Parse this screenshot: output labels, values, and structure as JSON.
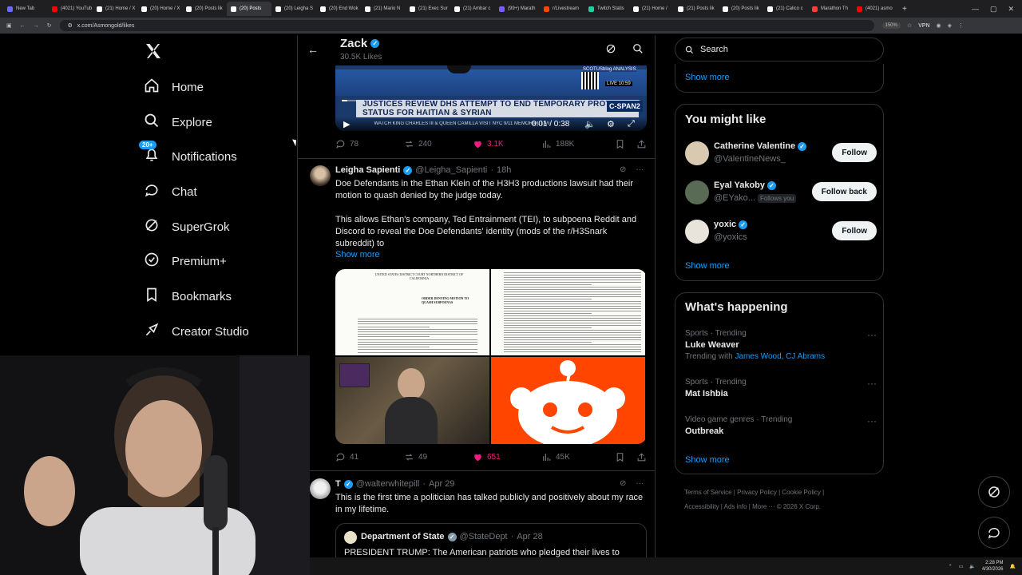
{
  "browser": {
    "tabs": [
      {
        "label": "New Tab",
        "color": "#6b6bff"
      },
      {
        "label": "(4021) YouTub",
        "color": "#ff0000"
      },
      {
        "label": "(21) Home / X",
        "color": "#ffffff"
      },
      {
        "label": "(20) Home / X",
        "color": "#ffffff"
      },
      {
        "label": "(20) Posts lik",
        "color": "#ffffff"
      },
      {
        "label": "(20) Posts",
        "color": "#ffffff"
      },
      {
        "label": "(20) Leigha S",
        "color": "#ffffff"
      },
      {
        "label": "(20) End Wok",
        "color": "#ffffff"
      },
      {
        "label": "(21) Mario N",
        "color": "#ffffff"
      },
      {
        "label": "(21) Exec Sur",
        "color": "#ffffff"
      },
      {
        "label": "(21) Ambar c",
        "color": "#ffffff"
      },
      {
        "label": "(99+) Marath",
        "color": "#7b5cff"
      },
      {
        "label": "r/Livestream",
        "color": "#ff4500"
      },
      {
        "label": "Twitch Statis",
        "color": "#1dd1a1"
      },
      {
        "label": "(21) Home /",
        "color": "#ffffff"
      },
      {
        "label": "(21) Posts lik",
        "color": "#ffffff"
      },
      {
        "label": "(20) Posts lik",
        "color": "#ffffff"
      },
      {
        "label": "(21) Calico c",
        "color": "#ffffff"
      },
      {
        "label": "Marathon Th",
        "color": "#ff3b3b"
      },
      {
        "label": "(4021) asmo",
        "color": "#ff0000"
      }
    ],
    "url": "x.com/Asmongold/likes",
    "zoom": "150%",
    "vpn_label": "VPN",
    "new_tab_symbol": "+"
  },
  "nav": {
    "items": [
      {
        "label": "Home",
        "icon": "home-icon"
      },
      {
        "label": "Explore",
        "icon": "search-icon"
      },
      {
        "label": "Notifications",
        "icon": "bell-icon",
        "badge": "20+"
      },
      {
        "label": "Chat",
        "icon": "chat-icon"
      },
      {
        "label": "SuperGrok",
        "icon": "grok-icon"
      },
      {
        "label": "Premium+",
        "icon": "premium-icon"
      },
      {
        "label": "Bookmarks",
        "icon": "bookmark-icon"
      },
      {
        "label": "Creator Studio",
        "icon": "creator-icon"
      }
    ]
  },
  "header": {
    "name": "Zack",
    "subtitle": "30.5K Likes"
  },
  "video_post": {
    "chyron": "JUSTICES REVIEW DHS ATTEMPT TO END TEMPORARY PROTECTED STATUS FOR HAITIAN & SYRIAN",
    "ticker": "WATCH KING CHARLES III & QUEEN CAMILLA VISIT NYC 9/11 MEMORIAL LIVE 1pm ET C-SPAN",
    "network": "C-SPAN2",
    "live_time": "LIVE 10:59",
    "watermark": "SCOTUSblog ANALYSIS",
    "time": "0:01 / 0:38",
    "progress": 0.02,
    "replies": "78",
    "reposts": "240",
    "likes": "3.1K",
    "views": "188K"
  },
  "tweet1": {
    "name": "Leigha Sapienti",
    "handle": "@Leigha_Sapienti",
    "time": "18h",
    "text": "Doe Defendants in the Ethan Klein of the H3H3 productions lawsuit had their motion to quash denied by the judge today.\n\nThis allows Ethan's company, Ted Entrainment (TEI), to subpoena Reddit and Discord to reveal the Doe Defendants' identity (mods of the r/H3Snark subreddit) to",
    "show_more": "Show more",
    "doc_header": "UNITED STATES DISTRICT COURT NORTHERN DISTRICT OF CALIFORNIA",
    "doc_title": "ORDER DENYING MOTION TO QUASH SUBPOENAS",
    "replies": "41",
    "reposts": "49",
    "likes": "651",
    "views": "45K"
  },
  "tweet2": {
    "name": "T",
    "handle": "@walterwhitepill",
    "time": "Apr 29",
    "text": "This is the first time a politician has talked publicly and positively about my race in my lifetime.",
    "quote_name": "Department of State",
    "quote_handle": "@StateDept",
    "quote_time": "Apr 28",
    "quote_text": "PRESIDENT TRUMP: The American patriots who pledged their lives to"
  },
  "right": {
    "search_placeholder": "Search",
    "show_more": "Show more",
    "you_might_like": "You might like",
    "suggestions": [
      {
        "name": "Catherine Valentine",
        "handle": "@ValentineNews_",
        "button": "Follow",
        "follows_you": "",
        "color": "#d8c9b0"
      },
      {
        "name": "Eyal Yakoby",
        "handle": "@EYako...",
        "button": "Follow back",
        "follows_you": "Follows you",
        "color": "#5a6b55"
      },
      {
        "name": "yoxic",
        "handle": "@yoxics",
        "button": "Follow",
        "follows_you": "",
        "color": "#e8e4dc"
      }
    ],
    "whats_happening": "What's happening",
    "trends": [
      {
        "meta": "Sports · Trending",
        "title": "Luke Weaver",
        "sub_prefix": "Trending with",
        "sub_links": "James Wood, CJ Abrams"
      },
      {
        "meta": "Sports · Trending",
        "title": "Mat Ishbia",
        "sub_prefix": "",
        "sub_links": ""
      },
      {
        "meta": "Video game genres · Trending",
        "title": "Outbreak",
        "sub_prefix": "",
        "sub_links": ""
      }
    ],
    "footer_line1": "Terms of Service  |  Privacy Policy  |  Cookie Policy  |",
    "footer_line2": "Accessibility  |  Ads info  |  More ···  © 2026 X Corp."
  },
  "taskbar": {
    "time": "2:28 PM",
    "date": "4/30/2026"
  },
  "colors": {
    "accent": "#1d9bf0",
    "like": "#f91880",
    "border": "#2f3336",
    "muted": "#71767b"
  }
}
